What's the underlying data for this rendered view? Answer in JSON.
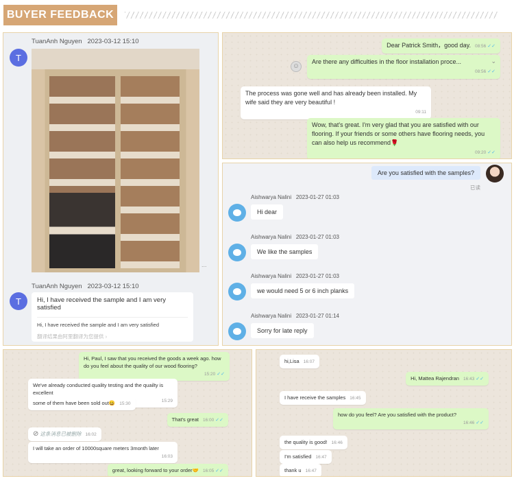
{
  "header": {
    "title": "BUYER FEEDBACK"
  },
  "panel1": {
    "msg1": {
      "sender": "TuanAnh Nguyen",
      "time": "2023-03-12 15:10",
      "avatar": "T"
    },
    "more": "...",
    "msg2": {
      "sender": "TuanAnh Nguyen",
      "time": "2023-03-12 15:10",
      "avatar": "T",
      "text": "Hi, I have received the sample and I am very satisfied",
      "translation": "Hi, I have received the sample and I am very satisfied",
      "note": "翻译结果由阿里翻译为您提供 ›"
    }
  },
  "panel2": {
    "messages": [
      {
        "text": "Dear Patrick Smith，good day.",
        "time": "08:56"
      },
      {
        "text": "Are there any difficulties in the floor installation proce...",
        "time": "08:56"
      },
      {
        "text": "The process was gone well and has already been installed. My wife said they are very beautiful !",
        "time": "09:11"
      },
      {
        "text": "Wow, that's great. I'm very glad that you are satisfied with our flooring. If your friends or some others have flooring needs, you can also help us recommend🌹",
        "time": "09:20"
      }
    ]
  },
  "panel3": {
    "question": "Are you satisfied with the samples?",
    "read": "已读",
    "sender": "Aishwarya Nalini",
    "messages": [
      {
        "time": "2023-01-27 01:03",
        "text": "Hi dear"
      },
      {
        "time": "2023-01-27 01:03",
        "text": "We like the samples"
      },
      {
        "time": "2023-01-27 01:03",
        "text": "we would need 5 or 6 inch planks"
      },
      {
        "time": "2023-01-27 01:14",
        "text": "Sorry for late reply"
      }
    ]
  },
  "panel4": {
    "messages": [
      {
        "text": "Hi, Paul, I saw that you received the goods a week ago. how do you feel about the quality of our wood flooring?",
        "time": "15:20"
      },
      {
        "text": "We've already conducted quality testing and the quailty is excellent",
        "time": "15:29"
      },
      {
        "text": "some of them have been sold out😀",
        "time": "15:30"
      },
      {
        "text": "That's great",
        "time": "16:00"
      },
      {
        "text": "这条消息已被删除",
        "time": "16:02"
      },
      {
        "text": "I will take an order of 10000square meters 3month later",
        "time": "16:03"
      },
      {
        "text": "great, looking forward to your order🤝",
        "time": "16:05"
      }
    ]
  },
  "panel5": {
    "messages": [
      {
        "text": "hi,Lisa",
        "time": "16:07"
      },
      {
        "text": "Hi, Mattea Rajendran",
        "time": "16:43"
      },
      {
        "text": "I have receive the samples",
        "time": "16:45"
      },
      {
        "text": "how do you feel? Are you satisfied with the product?",
        "time": "16:46"
      },
      {
        "text": "the quality is good!",
        "time": "16:46"
      },
      {
        "text": "I'm satisfied",
        "time": "16:47"
      },
      {
        "text": "thank u",
        "time": "16:47"
      }
    ]
  }
}
